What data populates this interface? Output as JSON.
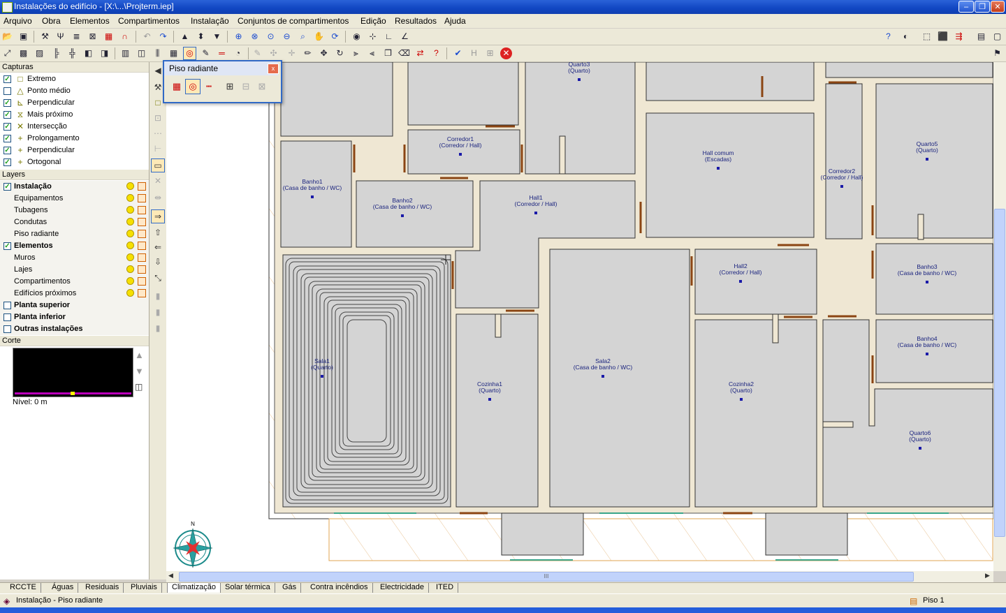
{
  "window": {
    "title": "Instalações do edifício - [X:\\...\\Projterm.iep]",
    "minimize_glyph": "–",
    "restore_glyph": "❐",
    "close_glyph": "✕"
  },
  "menu": [
    "Arquivo",
    "Obra",
    "Elementos",
    "Compartimentos",
    "Instalação",
    "Conjuntos de compartimentos",
    "Edição",
    "Resultados",
    "Ajuda"
  ],
  "left_panel": {
    "capturas_title": "Capturas",
    "capturas": [
      {
        "label": "Extremo",
        "checked": true,
        "icon": "square-snap-icon"
      },
      {
        "label": "Ponto médio",
        "checked": false,
        "icon": "triangle-snap-icon"
      },
      {
        "label": "Perpendicular",
        "checked": true,
        "icon": "perpendicular-snap-icon"
      },
      {
        "label": "Mais próximo",
        "checked": true,
        "icon": "nearest-snap-icon"
      },
      {
        "label": "Intersecção",
        "checked": true,
        "icon": "intersection-snap-icon"
      },
      {
        "label": "Prolongamento",
        "checked": true,
        "icon": "plus-snap-icon"
      },
      {
        "label": "Perpendicular",
        "checked": true,
        "icon": "plus-snap-icon"
      },
      {
        "label": "Ortogonal",
        "checked": true,
        "icon": "plus-snap-icon"
      }
    ],
    "layers_title": "Layers",
    "layers": [
      {
        "label": "Instalação",
        "checked": true,
        "bold": true
      },
      {
        "label": "Equipamentos",
        "indent": true
      },
      {
        "label": "Tubagens",
        "indent": true
      },
      {
        "label": "Condutas",
        "indent": true
      },
      {
        "label": "Piso radiante",
        "indent": true
      },
      {
        "label": "Elementos",
        "checked": true,
        "bold": true
      },
      {
        "label": "Muros",
        "indent": true
      },
      {
        "label": "Lajes",
        "indent": true
      },
      {
        "label": "Compartimentos",
        "indent": true
      },
      {
        "label": "Edifícios próximos",
        "indent": true
      },
      {
        "label": "Planta superior",
        "checked": false,
        "bold": true
      },
      {
        "label": "Planta inferior",
        "checked": false,
        "bold": true
      },
      {
        "label": "Outras instalações",
        "checked": false,
        "bold": true
      }
    ],
    "corte_title": "Corte",
    "nivel": "Nível: 0 m"
  },
  "palette": {
    "title": "Piso radiante",
    "close": "x"
  },
  "rooms": [
    {
      "name": "Quarto3",
      "type": "(Quarto)"
    },
    {
      "name": "Corredor1",
      "type": "(Corredor / Hall)"
    },
    {
      "name": "Hall comum",
      "type": "(Escadas)"
    },
    {
      "name": "Quarto5",
      "type": "(Quarto)"
    },
    {
      "name": "Corredor2",
      "type": "(Corredor / Hall)"
    },
    {
      "name": "Banho1",
      "type": "(Casa de banho / WC)"
    },
    {
      "name": "Banho2",
      "type": "(Casa de banho / WC)"
    },
    {
      "name": "Hall1",
      "type": "(Corredor / Hall)"
    },
    {
      "name": "Hall2",
      "type": "(Corredor / Hall)"
    },
    {
      "name": "Banho3",
      "type": "(Casa de banho / WC)"
    },
    {
      "name": "Banho4",
      "type": "(Casa de banho / WC)"
    },
    {
      "name": "Sala1",
      "type": "(Quarto)"
    },
    {
      "name": "Cozinha1",
      "type": "(Quarto)"
    },
    {
      "name": "Sala2",
      "type": "(Casa de banho / WC)"
    },
    {
      "name": "Cozinha2",
      "type": "(Quarto)"
    },
    {
      "name": "Quarto6",
      "type": "(Quarto)"
    }
  ],
  "compass_north": "N",
  "tabs": [
    "RCCTE",
    "Águas",
    "Residuais",
    "Pluviais",
    "Climatização",
    "Solar térmica",
    "Gás",
    "Contra incêndios",
    "Electricidade",
    "ITED"
  ],
  "active_tab": "Climatização",
  "status": {
    "mode": "Instalação - Piso radiante",
    "floor": "Piso 1"
  },
  "scroll_grip": "III"
}
